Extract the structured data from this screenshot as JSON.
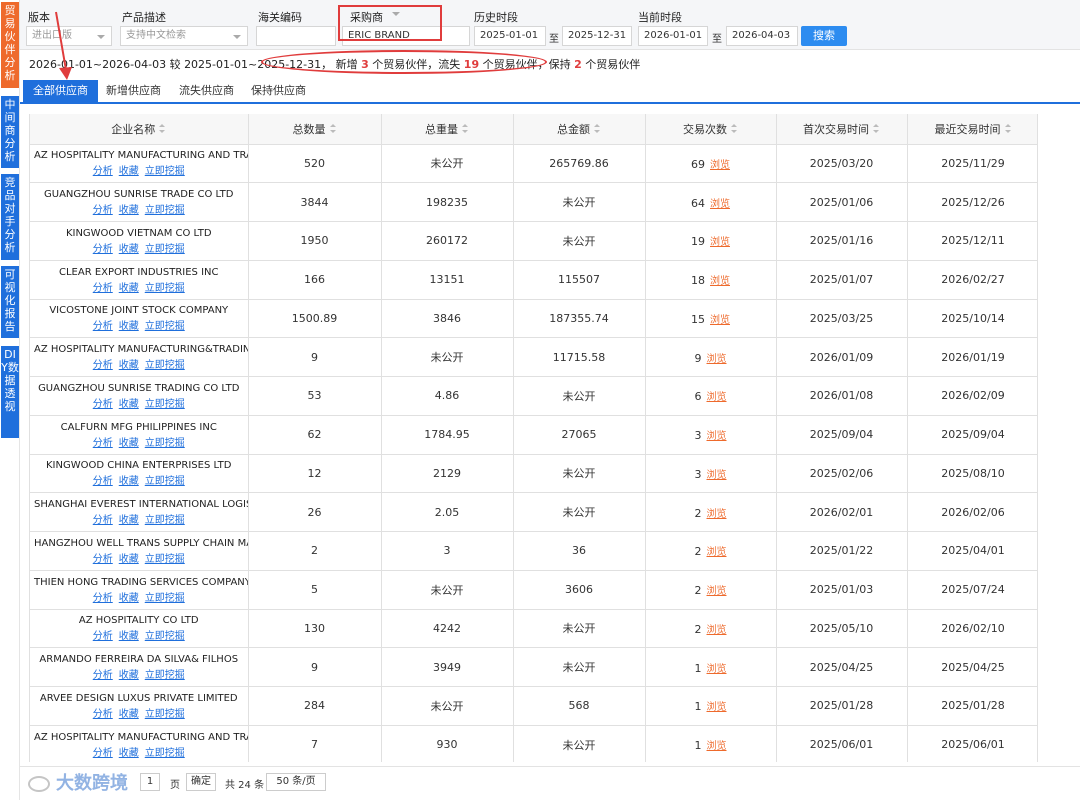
{
  "sidebar": {
    "tabs": [
      {
        "label": "贸易伙伴分析",
        "color": "#ee6a2c"
      },
      {
        "label": "中间商分析",
        "color": "#1f6fdc"
      },
      {
        "label": "竞品对手分析",
        "color": "#1f6fdc"
      },
      {
        "label": "可视化报告",
        "color": "#1f6fdc"
      },
      {
        "label": "DIY数据透视",
        "color": "#1f6fdc"
      }
    ]
  },
  "filters": {
    "edition_label": "版本",
    "edition_value": "进出口版",
    "product_label": "产品描述",
    "product_placeholder": "支持中文检索",
    "hs_label": "海关编码",
    "hs_value": "",
    "buyer_select": "采购商",
    "buyer_value": "ERIC BRAND",
    "history_label": "历史时段",
    "history_from": "2025-01-01",
    "history_to": "2025-12-31",
    "current_label": "当前时段",
    "current_from": "2026-01-01",
    "current_to": "2026-04-03",
    "to_word": "至",
    "search_button": "搜索"
  },
  "summary": {
    "prefix": "2026-01-01~2026-04-03 较 2025-01-01~2025-12-31，",
    "new_word": "新增",
    "new_count": "3",
    "partner_word_1": "个贸易伙伴，流失",
    "lost_count": "19",
    "partner_word_2": "个贸易伙伴，保持",
    "kept_count": "2",
    "partner_word_3": "个贸易伙伴"
  },
  "tabs": {
    "all": "全部供应商",
    "new": "新增供应商",
    "lost": "流失供应商",
    "kept": "保持供应商"
  },
  "table": {
    "headers": [
      "企业名称",
      "总数量",
      "总重量",
      "总金额",
      "交易次数",
      "首次交易时间",
      "最近交易时间"
    ],
    "action_labels": [
      "分析",
      "收藏",
      "立即挖掘"
    ],
    "browse_label": "浏览",
    "rows": [
      {
        "name": "AZ HOSPITALITY MANUFACTURING AND TRADING",
        "qty": "520",
        "weight": "未公开",
        "amount": "265769.86",
        "count": "69",
        "first": "2025/03/20",
        "last": "2025/11/29"
      },
      {
        "name": "GUANGZHOU SUNRISE TRADE CO LTD",
        "qty": "3844",
        "weight": "198235",
        "amount": "未公开",
        "count": "64",
        "first": "2025/01/06",
        "last": "2025/12/26"
      },
      {
        "name": "KINGWOOD VIETNAM CO LTD",
        "qty": "1950",
        "weight": "260172",
        "amount": "未公开",
        "count": "19",
        "first": "2025/01/16",
        "last": "2025/12/11"
      },
      {
        "name": "CLEAR EXPORT INDUSTRIES INC",
        "qty": "166",
        "weight": "13151",
        "amount": "115507",
        "count": "18",
        "first": "2025/01/07",
        "last": "2026/02/27"
      },
      {
        "name": "VICOSTONE JOINT STOCK COMPANY",
        "qty": "1500.89",
        "weight": "3846",
        "amount": "187355.74",
        "count": "15",
        "first": "2025/03/25",
        "last": "2025/10/14"
      },
      {
        "name": "AZ HOSPITALITY MANUFACTURING&TRADING",
        "qty": "9",
        "weight": "未公开",
        "amount": "11715.58",
        "count": "9",
        "first": "2026/01/09",
        "last": "2026/01/19"
      },
      {
        "name": "GUANGZHOU SUNRISE TRADING CO LTD",
        "qty": "53",
        "weight": "4.86",
        "amount": "未公开",
        "count": "6",
        "first": "2026/01/08",
        "last": "2026/02/09"
      },
      {
        "name": "CALFURN MFG PHILIPPINES INC",
        "qty": "62",
        "weight": "1784.95",
        "amount": "27065",
        "count": "3",
        "first": "2025/09/04",
        "last": "2025/09/04"
      },
      {
        "name": "KINGWOOD CHINA ENTERPRISES LTD",
        "qty": "12",
        "weight": "2129",
        "amount": "未公开",
        "count": "3",
        "first": "2025/02/06",
        "last": "2025/08/10"
      },
      {
        "name": "SHANGHAI EVEREST INTERNATIONAL LOGISTICS",
        "qty": "26",
        "weight": "2.05",
        "amount": "未公开",
        "count": "2",
        "first": "2026/02/01",
        "last": "2026/02/06"
      },
      {
        "name": "HANGZHOU WELL TRANS SUPPLY CHAIN MANAGEMENT",
        "qty": "2",
        "weight": "3",
        "amount": "36",
        "count": "2",
        "first": "2025/01/22",
        "last": "2025/04/01"
      },
      {
        "name": "THIEN HONG TRADING SERVICES COMPANY",
        "qty": "5",
        "weight": "未公开",
        "amount": "3606",
        "count": "2",
        "first": "2025/01/03",
        "last": "2025/07/24"
      },
      {
        "name": "AZ HOSPITALITY CO LTD",
        "qty": "130",
        "weight": "4242",
        "amount": "未公开",
        "count": "2",
        "first": "2025/05/10",
        "last": "2026/02/10"
      },
      {
        "name": "ARMANDO FERREIRA DA SILVA& FILHOS",
        "qty": "9",
        "weight": "3949",
        "amount": "未公开",
        "count": "1",
        "first": "2025/04/25",
        "last": "2025/04/25"
      },
      {
        "name": "ARVEE DESIGN LUXUS PRIVATE LIMITED",
        "qty": "284",
        "weight": "未公开",
        "amount": "568",
        "count": "1",
        "first": "2025/01/28",
        "last": "2025/01/28"
      },
      {
        "name": "AZ HOSPITALITY MANUFACTURING AND TRADING",
        "qty": "7",
        "weight": "930",
        "amount": "未公开",
        "count": "1",
        "first": "2025/06/01",
        "last": "2025/06/01"
      }
    ]
  },
  "pager": {
    "watermark": "大数跨境",
    "page_input": "1",
    "page_word": "页",
    "confirm": "确定",
    "total": "共 24 条",
    "per_page": "50 条/页"
  },
  "colors": {
    "accent": "#1f6fdc",
    "orange": "#ee6a2c",
    "annotation_red": "#e03c3c"
  }
}
